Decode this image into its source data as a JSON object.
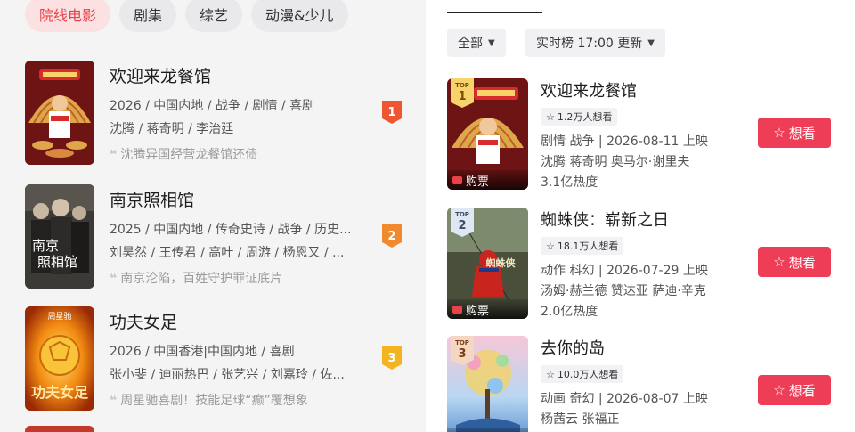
{
  "left": {
    "tabs": [
      {
        "label": "院线电影",
        "active": true
      },
      {
        "label": "剧集",
        "active": false
      },
      {
        "label": "综艺",
        "active": false
      },
      {
        "label": "动漫&少儿",
        "active": false
      }
    ],
    "items": [
      {
        "rank": "1",
        "title": "欢迎来龙餐馆",
        "meta": "2026 / 中国内地 / 战争 / 剧情 / 喜剧",
        "cast": "沈腾 / 蒋奇明 / 李治廷",
        "quote": "沈腾异国经营龙餐馆还债",
        "badge_color": "#ee5532"
      },
      {
        "rank": "2",
        "title": "南京照相馆",
        "meta": "2025 / 中国内地 / 传奇史诗 / 战争 / 历史...",
        "cast": "刘昊然 / 王传君 / 高叶 / 周游 / 杨恩又 / ...",
        "quote": "南京沦陷，百姓守护罪证底片",
        "badge_color": "#f08a2c"
      },
      {
        "rank": "3",
        "title": "功夫女足",
        "meta": "2026 / 中国香港|中国内地 / 喜剧",
        "cast": "张小斐 / 迪丽热巴 / 张艺兴 / 刘嘉玲 / 佐...",
        "quote": "周星驰喜剧！技能足球“癫”覆想象",
        "badge_color": "#f4b41f"
      }
    ]
  },
  "right": {
    "filters": [
      "全部",
      "实时榜 17:00 更新"
    ],
    "buy_label": "购票",
    "want_label": "想看",
    "items": [
      {
        "top_label": "TOP",
        "rank": "1",
        "title": "欢迎来龙餐馆",
        "want": "1.2万人想看",
        "line1": "剧情 战争 | 2026-08-11 上映",
        "line2": "沈腾 蒋奇明 奥马尔·谢里夫",
        "line3": "3.1亿热度"
      },
      {
        "top_label": "TOP",
        "rank": "2",
        "title": "蜘蛛侠：崭新之日",
        "want": "18.1万人想看",
        "line1": "动作 科幻 | 2026-07-29 上映",
        "line2": "汤姆·赫兰德 赞达亚 萨迪·辛克",
        "line3": "2.0亿热度"
      },
      {
        "top_label": "TOP",
        "rank": "3",
        "title": "去你的岛",
        "want": "10.0万人想看",
        "line1": "动画 奇幻 | 2026-08-07 上映",
        "line2": "杨茜云 张福正",
        "line3": ""
      }
    ]
  },
  "colors": {
    "accent": "#e8434a",
    "want_button": "#ee3d57"
  },
  "icons": {
    "quote": "quote-icon",
    "star": "star-outline-icon",
    "caret": "caret-down-icon",
    "ticket": "ticket-icon"
  }
}
